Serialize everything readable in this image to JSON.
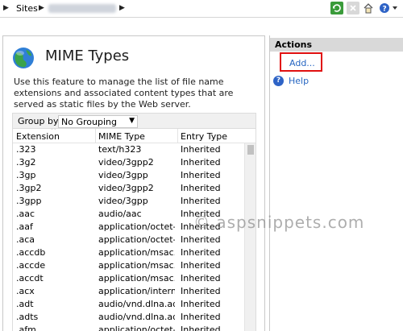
{
  "breadcrumb": {
    "items": [
      "Sites"
    ],
    "hidden_segment": "redacted site name"
  },
  "toolbar_icons": [
    "refresh-icon",
    "stop-icon",
    "home-icon",
    "help-icon"
  ],
  "feature": {
    "title": "MIME Types",
    "description": "Use this feature to manage the list of file name extensions and associated content types that are served as static files by the Web server.",
    "group_by_label": "Group by:",
    "group_by_value": "No Grouping"
  },
  "grid": {
    "columns": [
      "Extension",
      "MIME Type",
      "Entry Type"
    ],
    "rows": [
      [
        ".323",
        "text/h323",
        "Inherited"
      ],
      [
        ".3g2",
        "video/3gpp2",
        "Inherited"
      ],
      [
        ".3gp",
        "video/3gpp",
        "Inherited"
      ],
      [
        ".3gp2",
        "video/3gpp2",
        "Inherited"
      ],
      [
        ".3gpp",
        "video/3gpp",
        "Inherited"
      ],
      [
        ".aac",
        "audio/aac",
        "Inherited"
      ],
      [
        ".aaf",
        "application/octet-...",
        "Inherited"
      ],
      [
        ".aca",
        "application/octet-...",
        "Inherited"
      ],
      [
        ".accdb",
        "application/msac...",
        "Inherited"
      ],
      [
        ".accde",
        "application/msac...",
        "Inherited"
      ],
      [
        ".accdt",
        "application/msac...",
        "Inherited"
      ],
      [
        ".acx",
        "application/intern...",
        "Inherited"
      ],
      [
        ".adt",
        "audio/vnd.dlna.adts",
        "Inherited"
      ],
      [
        ".adts",
        "audio/vnd.dlna.adts",
        "Inherited"
      ],
      [
        ".afm",
        "application/octet-...",
        "Inherited"
      ]
    ]
  },
  "actions": {
    "title": "Actions",
    "add_label": "Add...",
    "help_label": "Help"
  },
  "watermark": "© aspsnippets.com",
  "colors": {
    "link": "#2766c2",
    "highlight_box": "#e01010",
    "actions_header": "#d9d9d9"
  }
}
